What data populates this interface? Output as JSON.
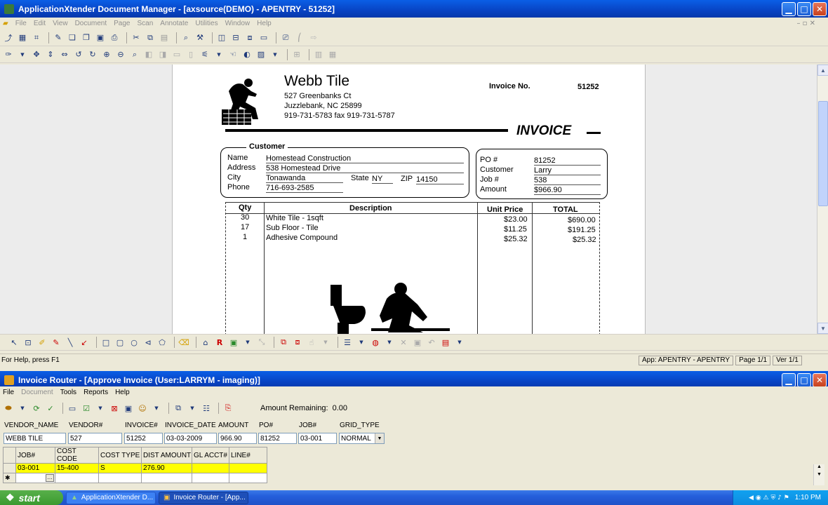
{
  "main_window": {
    "title": "ApplicationXtender Document Manager - [axsource(DEMO) - APENTRY - 51252]",
    "menu": [
      "File",
      "Edit",
      "View",
      "Document",
      "Page",
      "Scan",
      "Annotate",
      "Utilities",
      "Window",
      "Help"
    ]
  },
  "invoice": {
    "company": "Webb Tile",
    "address": "527 Greenbanks Ct",
    "city": "Juzzlebank, NC  25899",
    "phone": "919-731-5783 fax 919-731-5787",
    "invoice_label": "Invoice No.",
    "invoice_no": "51252",
    "invoice_title": "INVOICE",
    "customer_label": "Customer",
    "name_label": "Name",
    "name": "Homestead Construction",
    "address_label": "Address",
    "cust_address": "538 Homestead Drive",
    "city_label": "City",
    "cust_city": "Tonawanda",
    "state_label": "State",
    "state": "NY",
    "zip_label": "ZIP",
    "zip": "14150",
    "phone_label": "Phone",
    "cust_phone": "716-693-2585",
    "po_label": "PO #",
    "po": "81252",
    "customer2_label": "Customer",
    "customer2": "Larry",
    "job_label": "Job #",
    "job": "538",
    "amount_label": "Amount",
    "amount": "$966.90",
    "col_qty": "Qty",
    "col_desc": "Description",
    "col_price": "Unit Price",
    "col_total": "TOTAL",
    "lines": [
      {
        "qty": "30",
        "desc": "White Tile - 1sqft",
        "price": "$23.00",
        "total": "$690.00"
      },
      {
        "qty": "17",
        "desc": "Sub Floor - Tile",
        "price": "$11.25",
        "total": "$191.25"
      },
      {
        "qty": "1",
        "desc": "Adhesive Compound",
        "price": "$25.32",
        "total": "$25.32"
      }
    ]
  },
  "status": {
    "help": "For Help, press F1",
    "app": "App: APENTRY - APENTRY",
    "page": "Page 1/1",
    "ver": "Ver 1/1"
  },
  "router": {
    "title": "Invoice Router - [Approve Invoice (User:LARRYM - imaging)]",
    "menu": [
      "File",
      "Document",
      "Tools",
      "Reports",
      "Help"
    ],
    "amount_remaining_label": "Amount Remaining:",
    "amount_remaining": "0.00",
    "headers": [
      "VENDOR_NAME",
      "VENDOR#",
      "INVOICE#",
      "INVOICE_DATE",
      "AMOUNT",
      "PO#",
      "JOB#",
      "GRID_TYPE"
    ],
    "values": [
      "WEBB TILE",
      "527",
      "51252",
      "03-03-2009",
      "966.90",
      "81252",
      "03-001",
      "NORMAL"
    ],
    "grid_headers": [
      "JOB#",
      "COST CODE",
      "COST TYPE",
      "DIST AMOUNT",
      "GL ACCT#",
      "LINE#"
    ],
    "grid_row": [
      "03-001",
      "15-400",
      "S",
      "276.90",
      "",
      ""
    ]
  },
  "taskbar": {
    "start": "start",
    "task1": "ApplicationXtender D...",
    "task2": "Invoice Router - [App...",
    "clock": "1:10 PM"
  }
}
